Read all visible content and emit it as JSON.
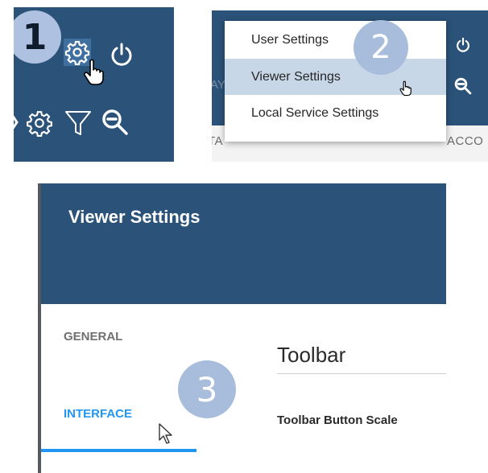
{
  "panel1": {
    "step_number": "1",
    "icons": [
      "gear-icon",
      "power-icon",
      "gear-icon",
      "filter-icon",
      "zoom-out-icon",
      "hand-pointer-cursor"
    ]
  },
  "panel2": {
    "step_number": "2",
    "left_edge_text": "AY",
    "right_strip_text": "ACCO",
    "left_strip_text": "TA",
    "menu": {
      "items": [
        {
          "label": "User Settings"
        },
        {
          "label": "Viewer Settings",
          "selected": true
        },
        {
          "label": "Local Service Settings"
        }
      ]
    }
  },
  "panel3": {
    "step_number": "3",
    "dialog_title": "Viewer Settings",
    "tabs": [
      {
        "label": "GENERAL",
        "active": false
      },
      {
        "label": "INTERFACE",
        "active": true
      }
    ],
    "section_title": "Toolbar",
    "field_label": "Toolbar Button Scale"
  },
  "colors": {
    "header_blue": "#2b5279",
    "active_tab_blue": "#2196f3",
    "badge_fill": "#a8bcdc",
    "menu_selected": "#c8d7e7"
  }
}
